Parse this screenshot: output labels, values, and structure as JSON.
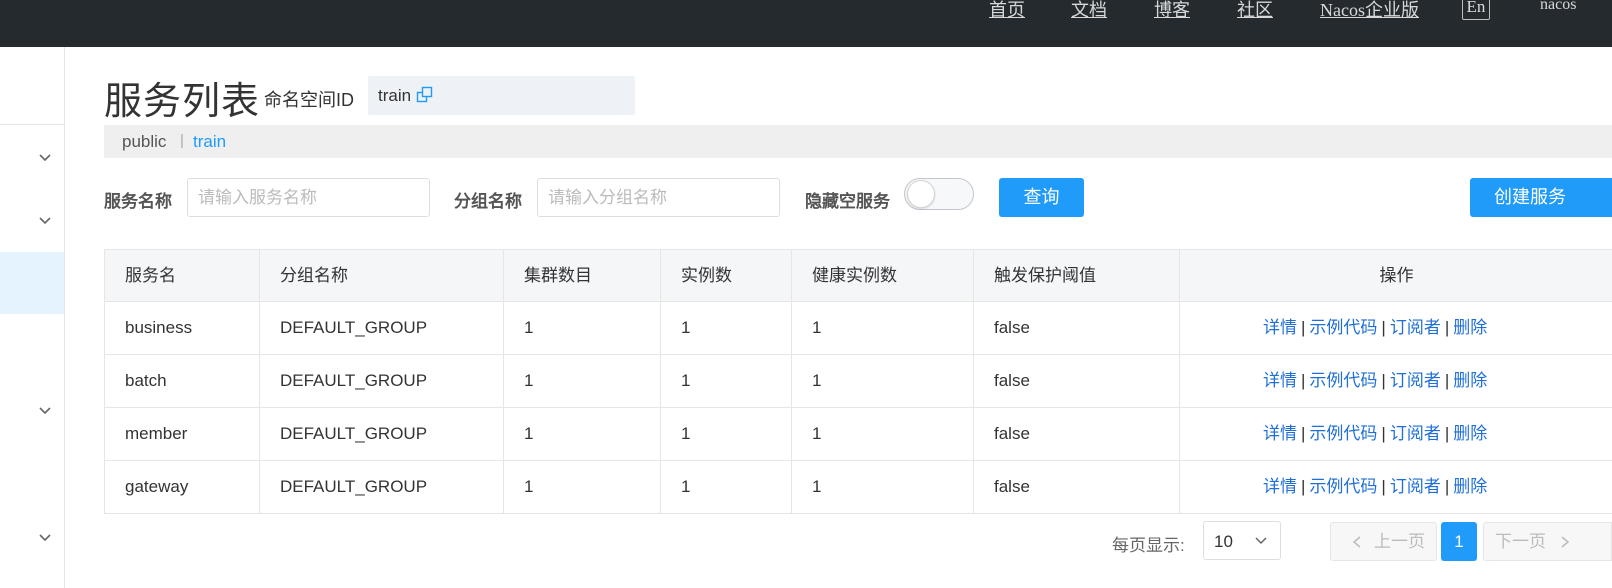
{
  "topnav": {
    "items": [
      "首页",
      "文档",
      "博客",
      "社区",
      "Nacos企业版"
    ],
    "lang": "En",
    "user": "nacos"
  },
  "header": {
    "title": "服务列表",
    "namespace_label": "命名空间ID",
    "namespace_value": "train"
  },
  "namespaces": {
    "items": [
      "public",
      "train"
    ],
    "separator": "|",
    "active": "train"
  },
  "filters": {
    "service_name_label": "服务名称",
    "service_name_placeholder": "请输入服务名称",
    "group_name_label": "分组名称",
    "group_name_placeholder": "请输入分组名称",
    "hide_empty_label": "隐藏空服务",
    "hide_empty_on": false,
    "query_button": "查询",
    "create_button": "创建服务"
  },
  "table": {
    "columns": [
      "服务名",
      "分组名称",
      "集群数目",
      "实例数",
      "健康实例数",
      "触发保护阈值",
      "操作"
    ],
    "rows": [
      [
        "business",
        "DEFAULT_GROUP",
        "1",
        "1",
        "1",
        "false"
      ],
      [
        "batch",
        "DEFAULT_GROUP",
        "1",
        "1",
        "1",
        "false"
      ],
      [
        "member",
        "DEFAULT_GROUP",
        "1",
        "1",
        "1",
        "false"
      ],
      [
        "gateway",
        "DEFAULT_GROUP",
        "1",
        "1",
        "1",
        "false"
      ]
    ],
    "actions": [
      "详情",
      "示例代码",
      "订阅者",
      "删除"
    ],
    "action_separator": "|"
  },
  "pagination": {
    "per_page_label": "每页显示:",
    "per_page_value": "10",
    "prev": "上一页",
    "current": "1",
    "next": "下一页"
  },
  "colors": {
    "topbar": "#252a2f",
    "primary": "#209bfa",
    "link": "#1f6fd6",
    "active_namespace": "#209bfa"
  }
}
